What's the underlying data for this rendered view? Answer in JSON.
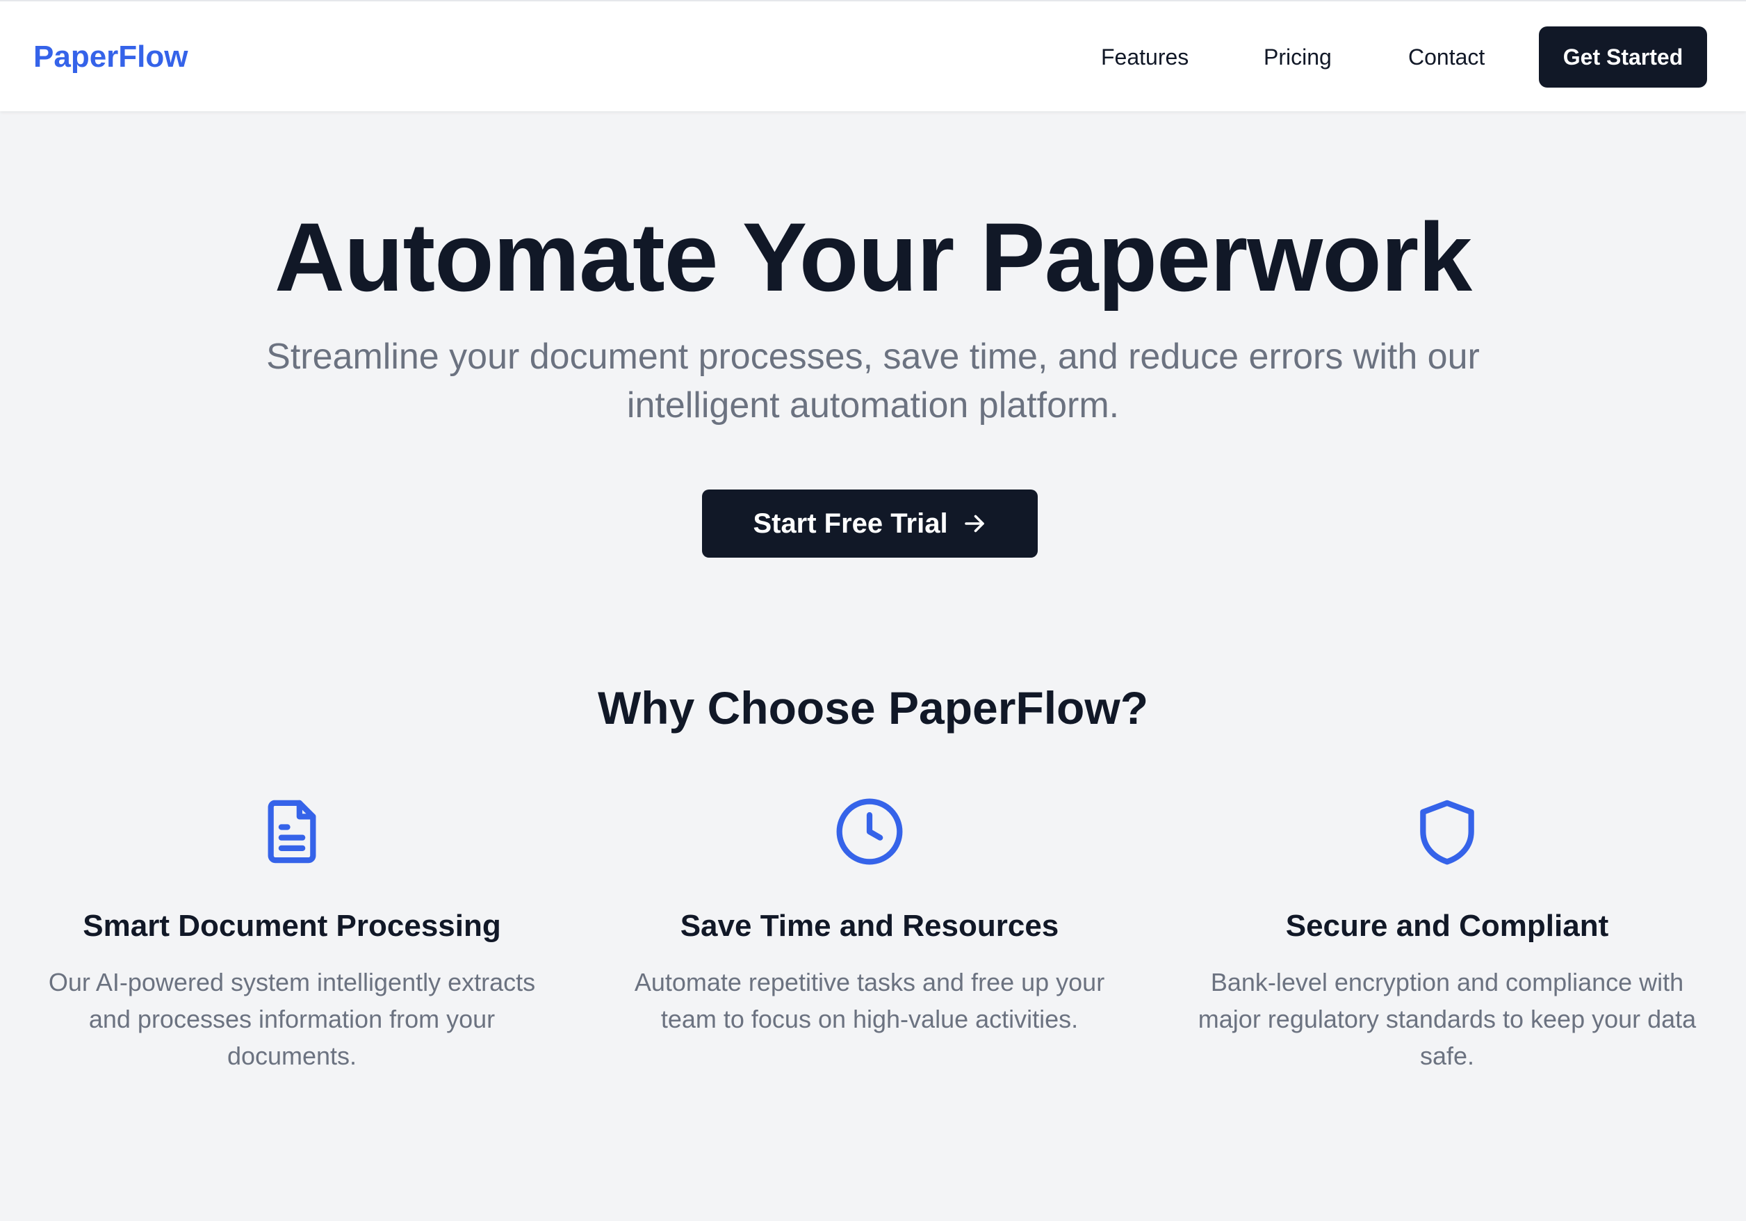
{
  "navbar": {
    "logo": "PaperFlow",
    "links": [
      "Features",
      "Pricing",
      "Contact"
    ],
    "cta_label": "Get Started"
  },
  "hero": {
    "title": "Automate Your Paperwork",
    "subtitle": "Streamline your document processes, save time, and reduce errors with our intelligent automation platform.",
    "cta_label": "Start Free Trial",
    "cta_icon": "arrow-right-icon"
  },
  "features": {
    "title": "Why Choose PaperFlow?",
    "items": [
      {
        "icon": "document-icon",
        "heading": "Smart Document Processing",
        "description": "Our AI-powered system intelligently extracts and processes information from your documents."
      },
      {
        "icon": "clock-icon",
        "heading": "Save Time and Resources",
        "description": "Automate repetitive tasks and free up your team to focus on high-value activities."
      },
      {
        "icon": "shield-icon",
        "heading": "Secure and Compliant",
        "description": "Bank-level encryption and compliance with major regulatory standards to keep your data safe."
      }
    ]
  },
  "colors": {
    "brand": "#3563e9",
    "dark": "#111827",
    "muted": "#6b7280",
    "background": "#f3f4f6"
  }
}
